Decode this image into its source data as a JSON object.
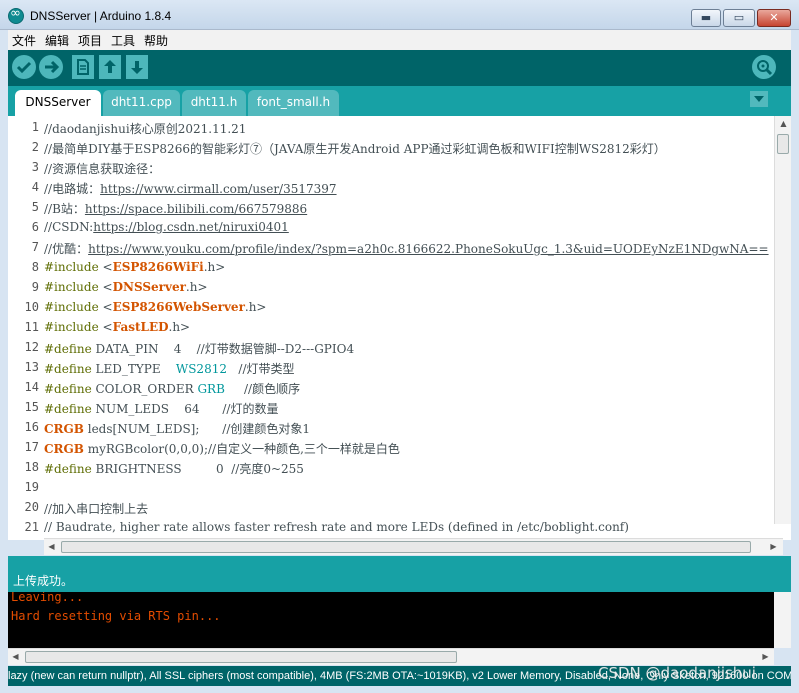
{
  "window": {
    "title": "DNSServer | Arduino 1.8.4",
    "minimize_glyph": "▬",
    "maximize_glyph": "▭",
    "close_glyph": "✕"
  },
  "menu": [
    "文件",
    "编辑",
    "项目",
    "工具",
    "帮助"
  ],
  "toolbar": {
    "buttons": [
      "verify-icon",
      "upload-icon",
      "new-icon",
      "open-icon",
      "save-icon",
      "serial-monitor-icon"
    ],
    "colors": {
      "bar": "#006468",
      "button": "#4db7bb"
    }
  },
  "tabs": [
    "DNSServer",
    "dht11.cpp",
    "dht11.h",
    "font_small.h"
  ],
  "active_tab": "DNSServer",
  "editor": {
    "line_numbers": [
      "1",
      "2",
      "3",
      "4",
      "5",
      "6",
      "7",
      "8",
      "9",
      "10",
      "11",
      "12",
      "13",
      "14",
      "15",
      "16",
      "17",
      "18",
      "19",
      "20",
      "21"
    ],
    "lines": [
      {
        "segments": [
          [
            "cmt",
            "//daodanjishui核心原创2021.11.21"
          ]
        ]
      },
      {
        "segments": [
          [
            "cmt",
            "//最简单DIY基于ESP8266的智能彩灯⑦（JAVA原生开发Android APP通过彩虹调色板和WIFI控制WS2812彩灯）"
          ]
        ]
      },
      {
        "segments": [
          [
            "cmt",
            "//资源信息获取途径："
          ]
        ]
      },
      {
        "segments": [
          [
            "cmt",
            "//电路城："
          ],
          [
            "url",
            "https://www.cirmall.com/user/3517397"
          ]
        ]
      },
      {
        "segments": [
          [
            "cmt",
            "//B站："
          ],
          [
            "url",
            "https://space.bilibili.com/667579886"
          ]
        ]
      },
      {
        "segments": [
          [
            "cmt",
            "//CSDN:"
          ],
          [
            "url",
            "https://blog.csdn.net/niruxi0401"
          ]
        ]
      },
      {
        "segments": [
          [
            "cmt",
            "//优酷："
          ],
          [
            "url",
            "https://www.youku.com/profile/index/?spm=a2h0c.8166622.PhoneSokuUgc_1.3&uid=UODEyNzE1NDgwNA=="
          ]
        ]
      },
      {
        "segments": [
          [
            "kw-pp",
            "#include "
          ],
          [
            "cmt",
            "<"
          ],
          [
            "lib",
            "ESP8266WiFi"
          ],
          [
            "cmt",
            ".h>"
          ]
        ]
      },
      {
        "segments": [
          [
            "kw-pp",
            "#include "
          ],
          [
            "cmt",
            "<"
          ],
          [
            "lib",
            "DNSServer"
          ],
          [
            "cmt",
            ".h>"
          ]
        ]
      },
      {
        "segments": [
          [
            "kw-pp",
            "#include "
          ],
          [
            "cmt",
            "<"
          ],
          [
            "lib",
            "ESP8266WebServer"
          ],
          [
            "cmt",
            ".h>"
          ]
        ]
      },
      {
        "segments": [
          [
            "kw-pp",
            "#include "
          ],
          [
            "cmt",
            "<"
          ],
          [
            "lib",
            "FastLED"
          ],
          [
            "cmt",
            ".h>"
          ]
        ]
      },
      {
        "segments": [
          [
            "kw-pp",
            "#define "
          ],
          [
            "cmt",
            "DATA_PIN    4    //灯带数据管脚--D2---GPIO4"
          ]
        ]
      },
      {
        "segments": [
          [
            "kw-pp",
            "#define "
          ],
          [
            "cmt",
            "LED_TYPE    "
          ],
          [
            "const",
            "WS2812"
          ],
          [
            "cmt",
            "   //灯带类型"
          ]
        ]
      },
      {
        "segments": [
          [
            "kw-pp",
            "#define "
          ],
          [
            "cmt",
            "COLOR_ORDER "
          ],
          [
            "const",
            "GRB"
          ],
          [
            "cmt",
            "     //颜色顺序"
          ]
        ]
      },
      {
        "segments": [
          [
            "kw-pp",
            "#define "
          ],
          [
            "cmt",
            "NUM_LEDS    64      //灯的数量"
          ]
        ]
      },
      {
        "segments": [
          [
            "kw-type",
            "CRGB"
          ],
          [
            "cmt",
            " leds[NUM_LEDS];      //创建颜色对象1"
          ]
        ]
      },
      {
        "segments": [
          [
            "kw-type",
            "CRGB"
          ],
          [
            "cmt",
            " myRGBcolor(0,0,0);//自定义一种颜色,三个一样就是白色"
          ]
        ]
      },
      {
        "segments": [
          [
            "kw-pp",
            "#define "
          ],
          [
            "cmt",
            "BRIGHTNESS         0  //亮度0~255"
          ]
        ]
      },
      {
        "segments": [
          [
            "cmt",
            ""
          ]
        ]
      },
      {
        "segments": [
          [
            "cmt",
            "//加入串口控制上去"
          ]
        ]
      },
      {
        "segments": [
          [
            "cmt",
            "// Baudrate, higher rate allows faster refresh rate and more LEDs (defined in /etc/boblight.conf)"
          ]
        ]
      }
    ]
  },
  "status": {
    "message": "上传成功。"
  },
  "console": {
    "lines": [
      "Leaving...",
      "Hard resetting via RTS pin..."
    ]
  },
  "footer": {
    "text": "lazy (new can return nullptr), All SSL ciphers (most compatible), 4MB (FS:2MB OTA:~1019KB), v2 Lower Memory, Disabled, None, Only Sketch, 921600 on COM5"
  },
  "watermark": "CSDN @daodanjishui"
}
